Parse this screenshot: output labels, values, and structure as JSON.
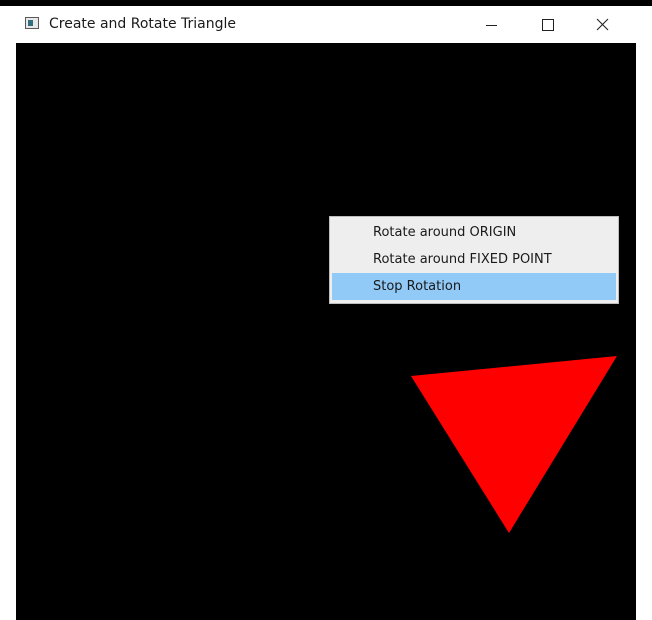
{
  "window": {
    "title": "Create and Rotate Triangle",
    "controls": {
      "minimize_icon": "minimize-icon",
      "maximize_icon": "maximize-icon",
      "close_icon": "close-icon"
    }
  },
  "canvas": {
    "background": "#000000",
    "shape": {
      "kind": "triangle",
      "fill": "#ff0000"
    }
  },
  "context_menu": {
    "items": [
      {
        "label": "Rotate around ORIGIN",
        "highlighted": false
      },
      {
        "label": "Rotate around FIXED POINT",
        "highlighted": false
      },
      {
        "label": "Stop Rotation",
        "highlighted": true
      }
    ],
    "highlight_color": "#91c9f7"
  }
}
